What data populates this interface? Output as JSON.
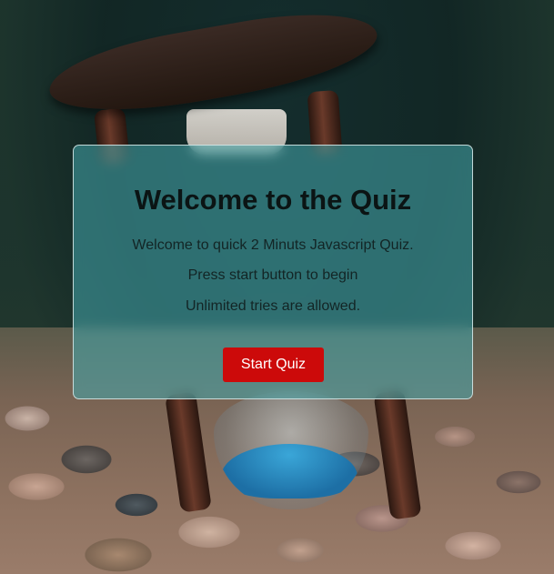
{
  "quiz": {
    "title": "Welcome to the Quiz",
    "lines": [
      "Welcome to quick 2 Minuts Javascript Quiz.",
      "Press start button to begin",
      "Unlimited tries are allowed."
    ],
    "start_button_label": "Start Quiz"
  },
  "colors": {
    "card_bg": "#46aaaf",
    "button_bg": "#cc0a0a",
    "button_text": "#ffffff",
    "sand": "#3aa6d8"
  },
  "background": {
    "image_subject": "hourglass-on-pebbles"
  }
}
